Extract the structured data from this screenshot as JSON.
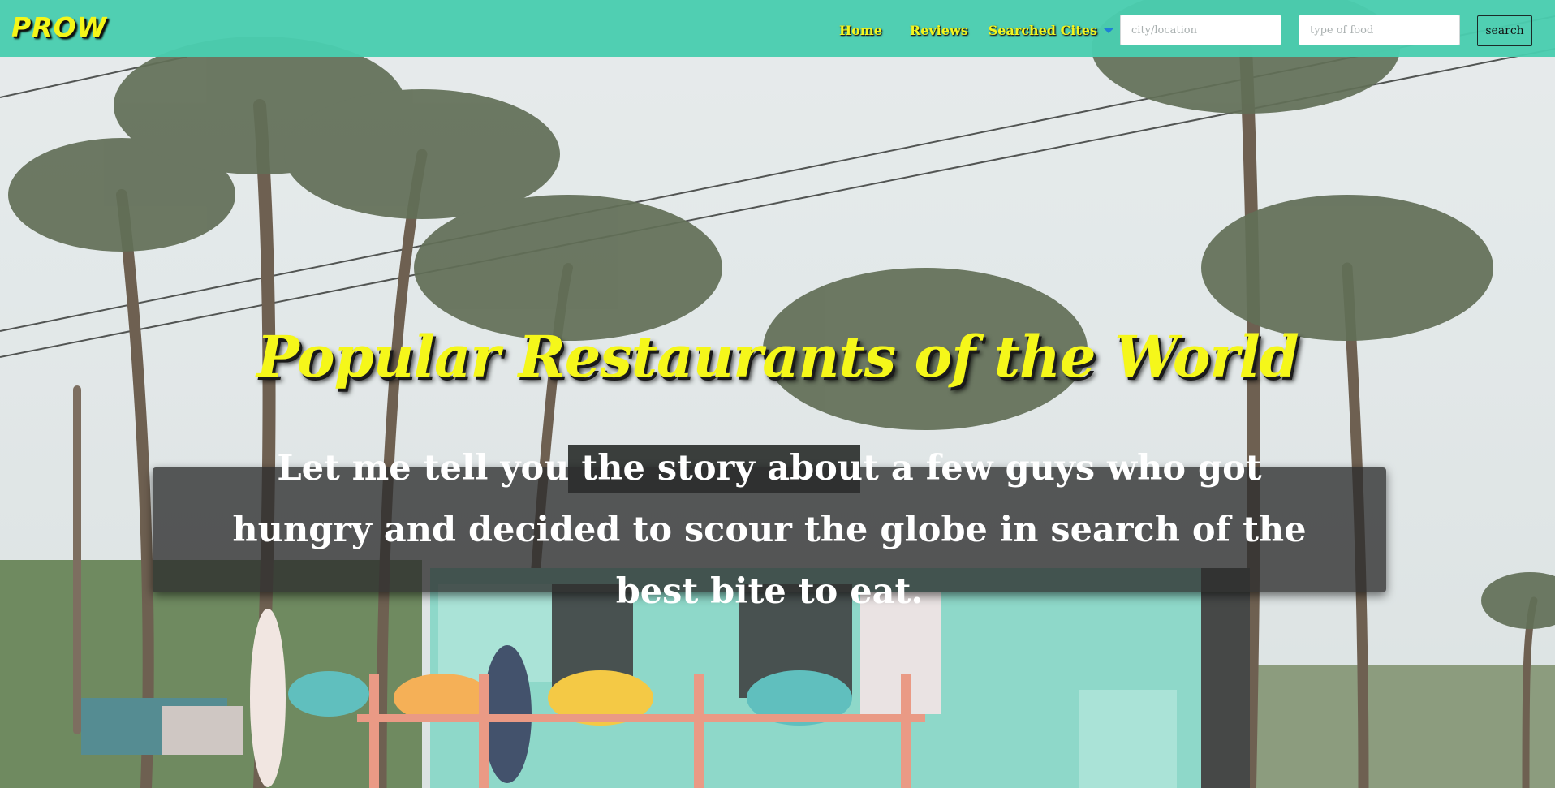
{
  "brand": {
    "name": "PROW"
  },
  "nav": {
    "home": "Home",
    "reviews": "Reviews",
    "searched_cites": "Searched Cites"
  },
  "search": {
    "city_placeholder": "city/location",
    "food_placeholder": "type of food",
    "button_label": "search"
  },
  "hero": {
    "title": "Popular Restaurants of the World",
    "story": "Let me tell you the story about a few guys who got hungry and decided to scour the globe in search of the best bite to eat."
  },
  "colors": {
    "navbar": "#4acdaf",
    "accent_yellow": "#f5f71a",
    "caret_blue": "#1f7fd6",
    "story_box": "#2d2d2d"
  }
}
